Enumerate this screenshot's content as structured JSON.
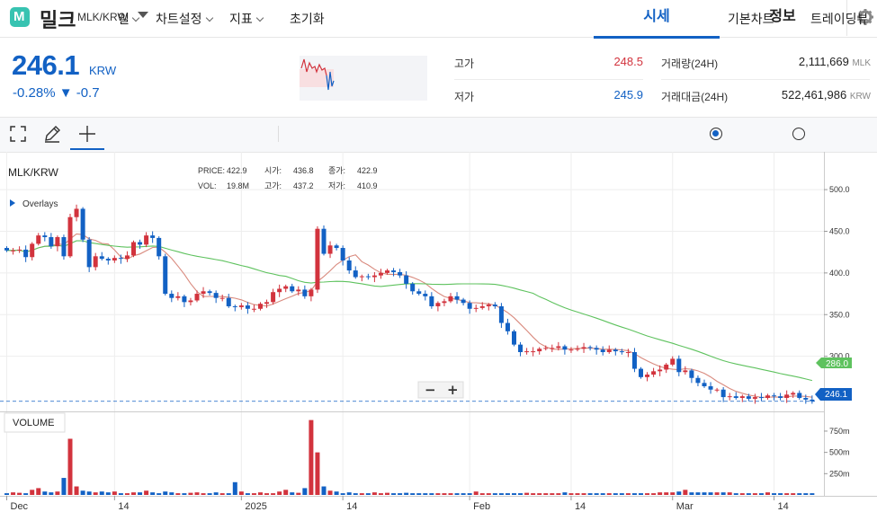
{
  "header": {
    "coin_name": "밀크",
    "pair": "MLK/KRW",
    "tabs": [
      {
        "label": "시세"
      },
      {
        "label": "정보"
      }
    ]
  },
  "price": {
    "current": "246.1",
    "unit": "KRW",
    "change": "-0.28% ▼ -0.7"
  },
  "stats": {
    "high_label": "고가",
    "high_value": "248.5",
    "low_label": "저가",
    "low_value": "245.9",
    "volume_label": "거래량(24H)",
    "volume_value": "2,111,669",
    "volume_unit": "MLK",
    "amount_label": "거래대금(24H)",
    "amount_value": "522,461,986",
    "amount_unit": "KRW"
  },
  "toolbar": {
    "interval_label": "일",
    "chart_settings_label": "차트설정",
    "indicator_label": "지표",
    "reset_label": "초기화",
    "basic_chart_label": "기본차트",
    "trading_view_label": "트레이딩뷰"
  },
  "chart": {
    "symbol": "MLK/KRW",
    "overlays_label": "Overlays",
    "info": {
      "price_label": "PRICE:",
      "price_value": "422.9",
      "open_label": "시가:",
      "open_value": "436.8",
      "close_label": "종가:",
      "close_value": "422.9",
      "vol_label": "VOL:",
      "vol_value": "19.8M",
      "high_label": "고가:",
      "high_value": "437.2",
      "low_label": "저가:",
      "low_value": "410.9"
    },
    "volume_label": "VOLUME",
    "current_tag": "246.1",
    "ma_tag": "286.0",
    "zoom_minus": "−",
    "zoom_plus": "+"
  },
  "chart_data": {
    "type": "candlestick",
    "y_axis_ticks": [
      "500.0",
      "450.0",
      "400.0",
      "350.0",
      "300.0"
    ],
    "y_axis_values": [
      500,
      450,
      400,
      350,
      300
    ],
    "volume_axis_ticks": [
      "750m",
      "500m",
      "250m"
    ],
    "volume_axis_values": [
      750,
      500,
      250
    ],
    "x_axis_labels": [
      "Dec",
      "14",
      "2025",
      "14",
      "Feb",
      "14",
      "Mar",
      "14"
    ],
    "x_axis_index": [
      0,
      17,
      37,
      53,
      73,
      89,
      105,
      121
    ],
    "ylim": [
      236,
      540
    ],
    "volume_ylim": [
      0,
      950
    ],
    "close": [
      427,
      427,
      428,
      419,
      435,
      445,
      443,
      432,
      443,
      420,
      467,
      477,
      440,
      407,
      420,
      417,
      415,
      418,
      417,
      421,
      437,
      434,
      445,
      442,
      420,
      375,
      370,
      372,
      365,
      367,
      375,
      378,
      376,
      370,
      370,
      360,
      359,
      361,
      357,
      357,
      363,
      365,
      377,
      381,
      384,
      378,
      380,
      372,
      380,
      453,
      423,
      433,
      430,
      415,
      403,
      395,
      396,
      395,
      397,
      400,
      403,
      401,
      397,
      387,
      378,
      375,
      372,
      360,
      364,
      366,
      372,
      368,
      364,
      357,
      358,
      360,
      362,
      360,
      340,
      330,
      314,
      305,
      306,
      306,
      309,
      310,
      310,
      312,
      308,
      308,
      309,
      311,
      310,
      308,
      305,
      308,
      306,
      305,
      305,
      285,
      275,
      278,
      282,
      284,
      290,
      297,
      281,
      283,
      274,
      268,
      264,
      260,
      260,
      251,
      252,
      250,
      252,
      249,
      251,
      250,
      253,
      252,
      250,
      254,
      256,
      250,
      248,
      246
    ],
    "volume": [
      20,
      30,
      25,
      20,
      60,
      80,
      40,
      30,
      40,
      200,
      660,
      100,
      50,
      40,
      30,
      40,
      30,
      40,
      20,
      20,
      30,
      30,
      50,
      30,
      20,
      40,
      30,
      20,
      20,
      25,
      30,
      20,
      20,
      30,
      20,
      20,
      150,
      40,
      20,
      20,
      30,
      20,
      20,
      40,
      60,
      30,
      25,
      80,
      880,
      500,
      100,
      50,
      40,
      20,
      30,
      20,
      20,
      20,
      30,
      20,
      25,
      20,
      20,
      25,
      20,
      20,
      20,
      20,
      20,
      20,
      20,
      20,
      20,
      20,
      40,
      20,
      20,
      20,
      20,
      20,
      20,
      20,
      25,
      20,
      20,
      20,
      20,
      20,
      30,
      20,
      20,
      20,
      20,
      20,
      20,
      20,
      20,
      20,
      20,
      20,
      20,
      20,
      20,
      30,
      30,
      30,
      40,
      60,
      30,
      30,
      30,
      30,
      30,
      30,
      30,
      20,
      20,
      20,
      20,
      20,
      30,
      20,
      20,
      20,
      20,
      20,
      20,
      20
    ],
    "up_color": "#d2333d",
    "down_color": "#1261c4",
    "ma_short_color": "#d98a7e",
    "ma_long_color": "#5ec25e"
  },
  "colors": {
    "accent": "#1261c4",
    "rise": "#d2333d",
    "fall": "#1261c4",
    "logo": "#37c3b1"
  }
}
